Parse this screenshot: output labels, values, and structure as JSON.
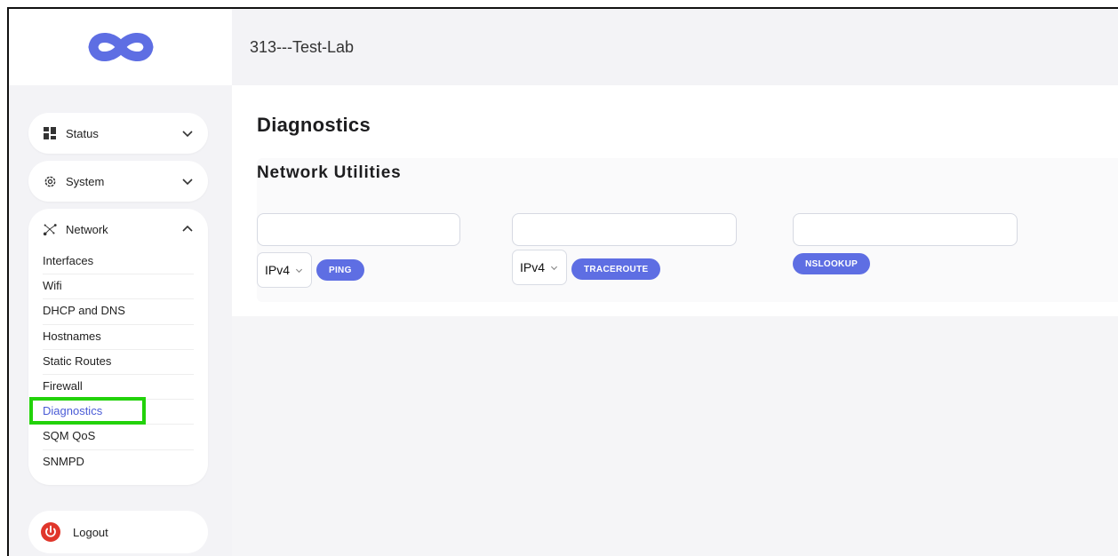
{
  "app": {
    "logo_icon": "infinity-logo-icon",
    "device_title": "313---Test-Lab",
    "accent_color": "#5e6ee3"
  },
  "sidebar": {
    "status": {
      "label": "Status",
      "icon": "dashboard-grid-icon"
    },
    "system": {
      "label": "System",
      "icon": "gear-icon"
    },
    "network": {
      "label": "Network",
      "icon": "network-nodes-icon",
      "items": [
        {
          "label": "Interfaces"
        },
        {
          "label": "Wifi"
        },
        {
          "label": "DHCP and DNS"
        },
        {
          "label": "Hostnames"
        },
        {
          "label": "Static Routes"
        },
        {
          "label": "Firewall"
        },
        {
          "label": "Diagnostics"
        },
        {
          "label": "SQM QoS"
        },
        {
          "label": "SNMPD"
        }
      ]
    },
    "logout": {
      "label": "Logout",
      "icon": "power-icon"
    }
  },
  "main": {
    "page_title": "Diagnostics",
    "section_title": "Network Utilities",
    "ping": {
      "input_value": "",
      "protocol": "IPv4",
      "button_label": "PING"
    },
    "traceroute": {
      "input_value": "",
      "protocol": "IPv4",
      "button_label": "TRACEROUTE"
    },
    "nslookup": {
      "input_value": "",
      "button_label": "NSLOOKUP"
    }
  }
}
